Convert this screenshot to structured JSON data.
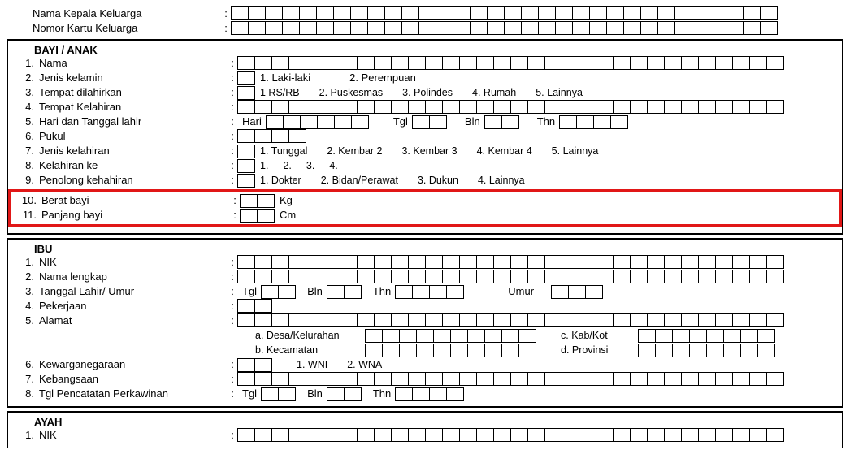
{
  "top": {
    "kk_name": "Nama Kepala Keluarga",
    "kk_number": "Nomor Kartu Keluarga"
  },
  "bayi": {
    "heading": "BAYI / ANAK",
    "items": [
      {
        "n": "1.",
        "label": "Nama"
      },
      {
        "n": "2.",
        "label": "Jenis kelamin",
        "opts": [
          "1.  Laki-laki",
          "2.  Perempuan"
        ]
      },
      {
        "n": "3.",
        "label": "Tempat dilahirkan",
        "opts": [
          "1  RS/RB",
          "2.  Puskesmas",
          "3.  Polindes",
          "4.  Rumah",
          "5.  Lainnya"
        ]
      },
      {
        "n": "4.",
        "label": "Tempat Kelahiran"
      },
      {
        "n": "5.",
        "label": "Hari dan Tanggal lahir",
        "dateparts": {
          "hari": "Hari",
          "tgl": "Tgl",
          "bln": "Bln",
          "thn": "Thn"
        }
      },
      {
        "n": "6.",
        "label": "Pukul"
      },
      {
        "n": "7.",
        "label": "Jenis kelahiran",
        "opts": [
          "1.  Tunggal",
          "2.  Kembar 2",
          "3.  Kembar 3",
          "4.  Kembar 4",
          "5.  Lainnya"
        ]
      },
      {
        "n": "8.",
        "label": "Kelahiran ke",
        "opts": [
          "1.",
          "2.",
          "3.",
          "4."
        ]
      },
      {
        "n": "9.",
        "label": "Penolong kehahiran",
        "opts": [
          "1.  Dokter",
          "2.  Bidan/Perawat",
          "3.  Dukun",
          "4.  Lainnya"
        ]
      },
      {
        "n": "10.",
        "label": "Berat bayi",
        "unit": "Kg"
      },
      {
        "n": "11.",
        "label": "Panjang bayi",
        "unit": "Cm"
      }
    ]
  },
  "ibu": {
    "heading": "IBU",
    "items": [
      {
        "n": "1.",
        "label": "NIK"
      },
      {
        "n": "2.",
        "label": "Nama lengkap"
      },
      {
        "n": "3.",
        "label": "Tanggal Lahir/ Umur",
        "dateparts": {
          "tgl": "Tgl",
          "bln": "Bln",
          "thn": "Thn",
          "umur": "Umur"
        }
      },
      {
        "n": "4.",
        "label": "Pekerjaan"
      },
      {
        "n": "5.",
        "label": "Alamat",
        "addr": {
          "a": "a.  Desa/Kelurahan",
          "b": "b.  Kecamatan",
          "c": "c.  Kab/Kot",
          "d": "d.  Provinsi"
        }
      },
      {
        "n": "6.",
        "label": "Kewarganegaraan",
        "opts": [
          "1.  WNI",
          "2.  WNA"
        ]
      },
      {
        "n": "7.",
        "label": "Kebangsaan"
      },
      {
        "n": "8.",
        "label": "Tgl Pencatatan Perkawinan",
        "dateparts": {
          "tgl": "Tgl",
          "bln": "Bln",
          "thn": "Thn"
        }
      }
    ]
  },
  "ayah": {
    "heading": "AYAH",
    "items": [
      {
        "n": "1.",
        "label": "NIK"
      }
    ]
  }
}
